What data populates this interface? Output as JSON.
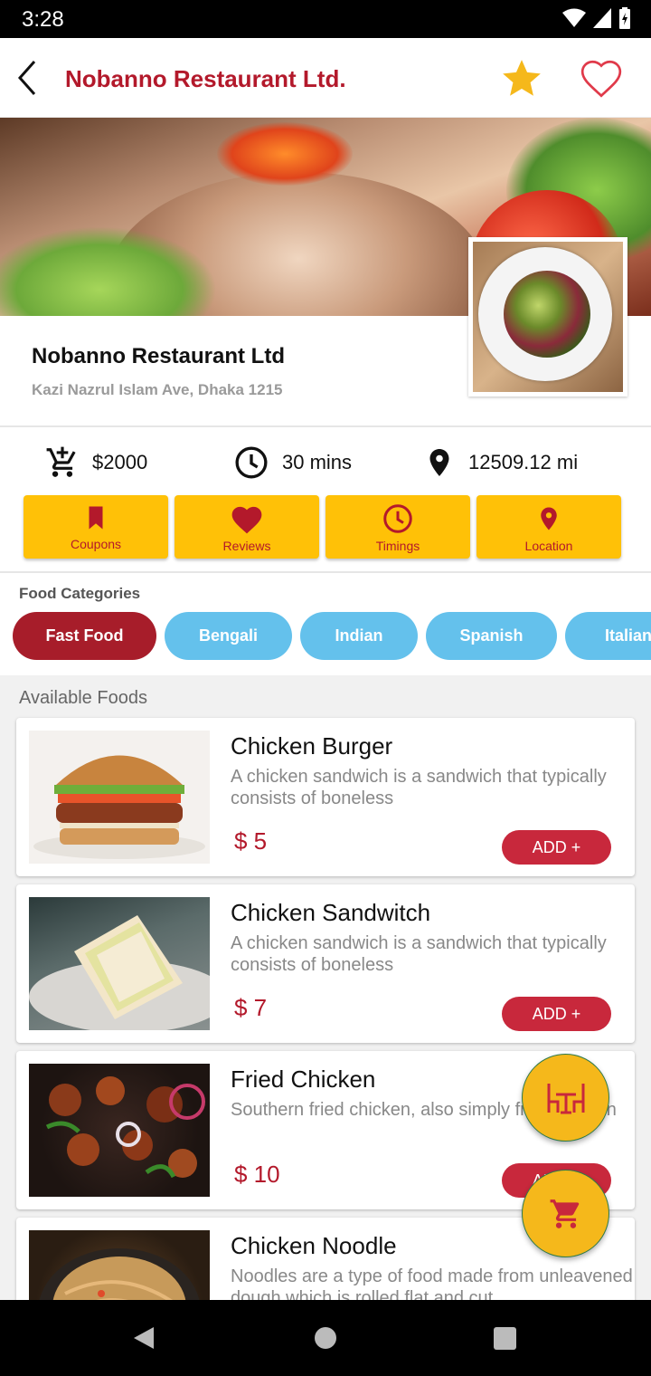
{
  "status_bar": {
    "time": "3:28"
  },
  "app_bar": {
    "title": "Nobanno Restaurant Ltd."
  },
  "restaurant": {
    "name": "Nobanno Restaurant Ltd",
    "address": "Kazi Nazrul Islam Ave, Dhaka 1215"
  },
  "info": {
    "min_order": "$2000",
    "delivery_time": "30 mins",
    "distance": "12509.12 mi"
  },
  "actions": [
    {
      "label": "Coupons",
      "icon": "bookmark-icon"
    },
    {
      "label": "Reviews",
      "icon": "heart-icon"
    },
    {
      "label": "Timings",
      "icon": "clock-icon"
    },
    {
      "label": "Location",
      "icon": "location-pin-icon"
    }
  ],
  "categories": {
    "heading": "Food Categories",
    "items": [
      "Fast Food",
      "Bengali",
      "Indian",
      "Spanish",
      "Italian"
    ],
    "active": "Fast Food"
  },
  "foods": {
    "heading": "Available Foods",
    "items": [
      {
        "name": "Chicken Burger",
        "desc": "A chicken sandwich is a sandwich that typically consists of boneless",
        "price": "$ 5",
        "add": "ADD +"
      },
      {
        "name": "Chicken Sandwitch",
        "desc": "A chicken sandwich is a sandwich that typically consists of boneless",
        "price": "$ 7",
        "add": "ADD +"
      },
      {
        "name": "Fried Chicken",
        "desc": "Southern fried chicken, also simply fried chicken",
        "price": "$ 10",
        "add": "ADD +"
      },
      {
        "name": "Chicken Noodle",
        "desc": "Noodles are a type of food made from unleavened dough which is rolled flat and cut",
        "price": "",
        "add": ""
      }
    ]
  },
  "colors": {
    "brand_red": "#b3192b",
    "yellow": "#ffc107",
    "chip_blue": "#64c1ec",
    "chip_active": "#a71d2a"
  }
}
